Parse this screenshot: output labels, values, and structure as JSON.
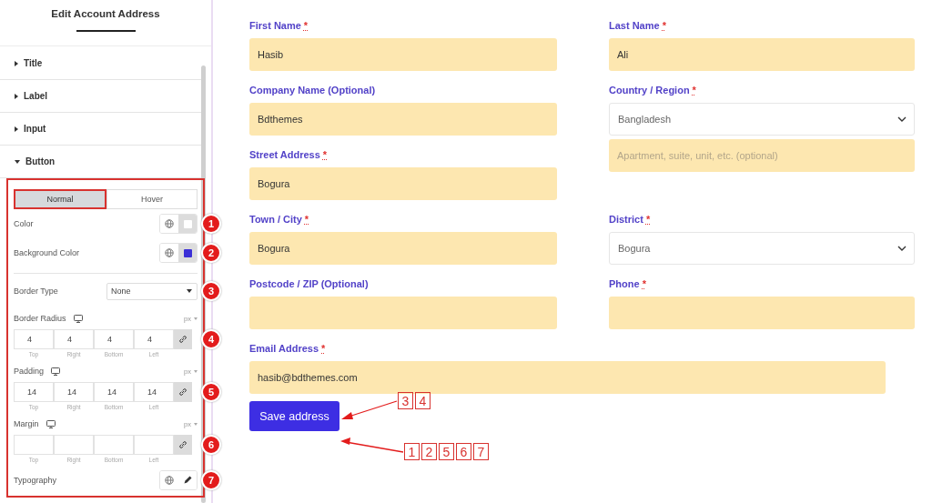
{
  "panel": {
    "title": "Edit Account Address",
    "sections": [
      {
        "label": "Title",
        "expanded": false
      },
      {
        "label": "Label",
        "expanded": false
      },
      {
        "label": "Input",
        "expanded": false
      },
      {
        "label": "Button",
        "expanded": true
      }
    ],
    "state_tabs": [
      {
        "label": "Normal",
        "selected": true
      },
      {
        "label": "Hover",
        "selected": false
      }
    ],
    "controls": [
      {
        "kind": "color",
        "label": "Color",
        "color": "#ffffff",
        "badge": "1"
      },
      {
        "kind": "color",
        "label": "Background Color",
        "color": "#3b2fd6",
        "badge": "2"
      },
      {
        "kind": "divider"
      },
      {
        "kind": "select",
        "label": "Border Type",
        "value": "None",
        "badge": "3"
      },
      {
        "kind": "dimensions",
        "label": "Border Radius",
        "unit": "px",
        "values": [
          "4",
          "4",
          "4",
          "4"
        ],
        "sides": [
          "Top",
          "Right",
          "Bottom",
          "Left"
        ],
        "badge": "4"
      },
      {
        "kind": "dimensions",
        "label": "Padding",
        "unit": "px",
        "values": [
          "14",
          "14",
          "14",
          "14"
        ],
        "sides": [
          "Top",
          "Right",
          "Bottom",
          "Left"
        ],
        "badge": "5"
      },
      {
        "kind": "dimensions",
        "label": "Margin",
        "unit": "px",
        "sides": [
          "Top",
          "Right",
          "Bottom",
          "Left"
        ],
        "badge": "6"
      },
      {
        "kind": "typography",
        "label": "Typography",
        "badge": "7"
      }
    ]
  },
  "form": {
    "rows": [
      [
        {
          "kind": "text",
          "label": "First Name",
          "mark": "*",
          "value": "Hasib"
        },
        {
          "kind": "text",
          "label": "Last Name",
          "mark": "*",
          "value": "Ali"
        }
      ],
      [
        {
          "kind": "text",
          "label": "Company Name (Optional)",
          "value": "Bdthemes"
        },
        {
          "kind": "select",
          "label": "Country / Region",
          "mark": "*",
          "value": "Bangladesh"
        }
      ],
      [
        {
          "kind": "text",
          "label": "Street Address",
          "mark": "*",
          "value": "Bogura"
        },
        {
          "kind": "text",
          "placeholder": "Apartment, suite, unit, etc. (optional)"
        }
      ],
      [
        {
          "kind": "text",
          "label": "Town / City",
          "mark": "*",
          "value": "Bogura"
        },
        {
          "kind": "select",
          "label": "District",
          "mark": "*",
          "value": "Bogura"
        }
      ],
      [
        {
          "kind": "text",
          "label": "Postcode / ZIP (Optional)"
        },
        {
          "kind": "text",
          "label": "Phone",
          "mark": "*"
        }
      ]
    ],
    "email": {
      "kind": "text",
      "label": "Email Address",
      "mark": "*",
      "value": "hasib@bdthemes.com"
    },
    "button": "Save address"
  },
  "callouts": [
    {
      "numbers": [
        "3",
        "4"
      ]
    },
    {
      "numbers": [
        "1",
        "2",
        "5",
        "6",
        "7"
      ]
    }
  ]
}
